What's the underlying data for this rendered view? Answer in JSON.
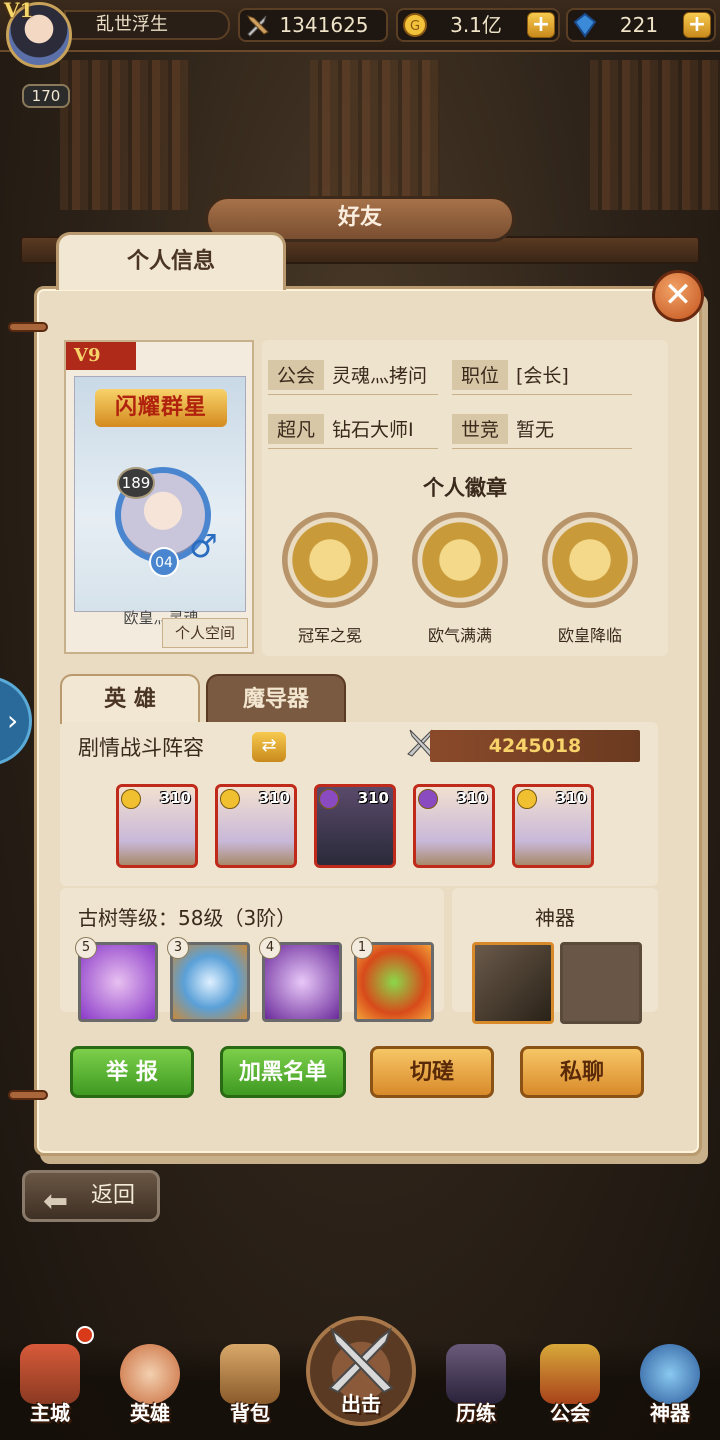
{
  "top": {
    "vip": "V1",
    "level": "170",
    "player_name": "乱世浮生",
    "combat_power": "1341625",
    "gold": "3.1亿",
    "gems": "221",
    "plus": "+"
  },
  "header": {
    "title": "好友"
  },
  "tabs": {
    "personal": "个人信息",
    "close": "✕"
  },
  "card": {
    "vip": "V9",
    "title": "闪耀群星",
    "level": "189",
    "star": "04",
    "gender": "♂",
    "name": "欧皇灬灵魂",
    "space_button": "个人空间"
  },
  "info": {
    "guild_label": "公会",
    "guild_value": "灵魂灬拷问",
    "position_label": "职位",
    "position_value": "[会长]",
    "rank_label": "超凡",
    "rank_value": "钻石大师Ⅰ",
    "arena_label": "世竞",
    "arena_value": "暂无",
    "badge_title": "个人徽章",
    "badges": [
      "冠军之冕",
      "欧气满满",
      "欧皇降临"
    ]
  },
  "hero_tabs": {
    "heroes": "英 雄",
    "mage": "魔导器"
  },
  "lineup": {
    "title": "剧情战斗阵容",
    "swap": "⇄",
    "power": "4245018",
    "heroes": [
      {
        "level": "310"
      },
      {
        "level": "310"
      },
      {
        "level": "310"
      },
      {
        "level": "310"
      },
      {
        "level": "310"
      }
    ]
  },
  "tree": {
    "title": "古树等级：58级（3阶）",
    "skills": [
      {
        "n": "5"
      },
      {
        "n": "3"
      },
      {
        "n": "4"
      },
      {
        "n": "1"
      }
    ]
  },
  "artifact": {
    "title": "神器"
  },
  "actions": {
    "report": "举 报",
    "blacklist": "加黑名单",
    "duel": "切磋",
    "chat": "私聊"
  },
  "back": {
    "label": "返回",
    "arrow": "⬅"
  },
  "side": {
    "arrow": "›"
  },
  "nav": {
    "items": [
      "主城",
      "英雄",
      "背包",
      "出击",
      "历练",
      "公会",
      "神器"
    ]
  },
  "colors": {
    "accent": "#d98a2a",
    "green": "#3f9a22",
    "red": "#c02a1a"
  },
  "icons": [
    "sword-icon",
    "gold-coin-icon",
    "gem-icon",
    "close-icon",
    "swap-icon",
    "back-arrow-icon"
  ]
}
